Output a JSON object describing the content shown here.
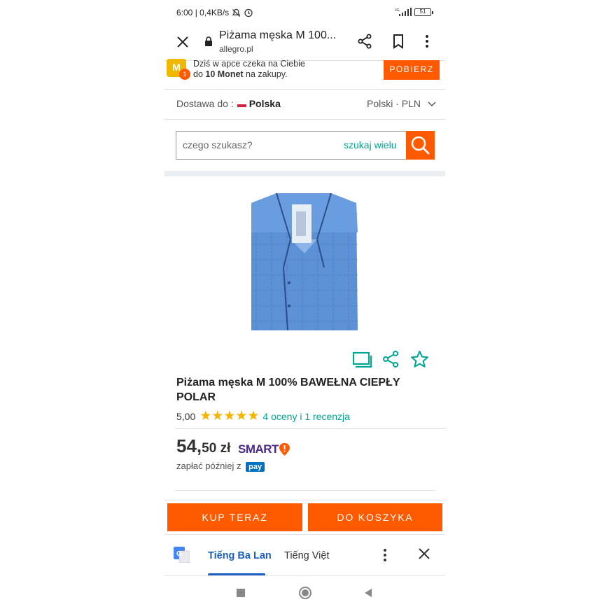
{
  "status_bar": {
    "time_info": "6:00 | 0,4KB/s",
    "battery": "51",
    "network": "4G"
  },
  "browser": {
    "title": "Piżama męska M 100...",
    "url": "allegro.pl"
  },
  "promo": {
    "line1": "Dziś w apce czeka na Ciebie",
    "line2_pre": "do ",
    "line2_bold": "10 Monet",
    "line2_post": " na zakupy.",
    "coin_letter": "M",
    "badge": "1",
    "button": "POBIERZ"
  },
  "delivery": {
    "label": "Dostawa do :",
    "country": "Polska",
    "language": "Polski · PLN"
  },
  "search": {
    "placeholder": "czego szukasz?",
    "many_label": "szukaj wielu"
  },
  "product": {
    "title": "Piżama męska M 100% BAWEŁNA CIEPŁY POLAR",
    "rating": "5,00",
    "stars": 5,
    "reviews_text": "4 oceny i 1 recenzja",
    "price_main": "54,",
    "price_cents": "50 zł",
    "smart_label": "SMART",
    "pay_later": "zapłać później z",
    "pay_badge": "pay"
  },
  "buttons": {
    "buy_now": "KUP TERAZ",
    "add_to_cart": "DO KOSZYKA"
  },
  "translate": {
    "source_lang": "Tiếng Ba Lan",
    "target_lang": "Tiếng Việt"
  },
  "colors": {
    "brand_orange": "#ff5a00",
    "teal": "#00a790",
    "star": "#f5b400",
    "translate_blue": "#1a5fc0"
  }
}
